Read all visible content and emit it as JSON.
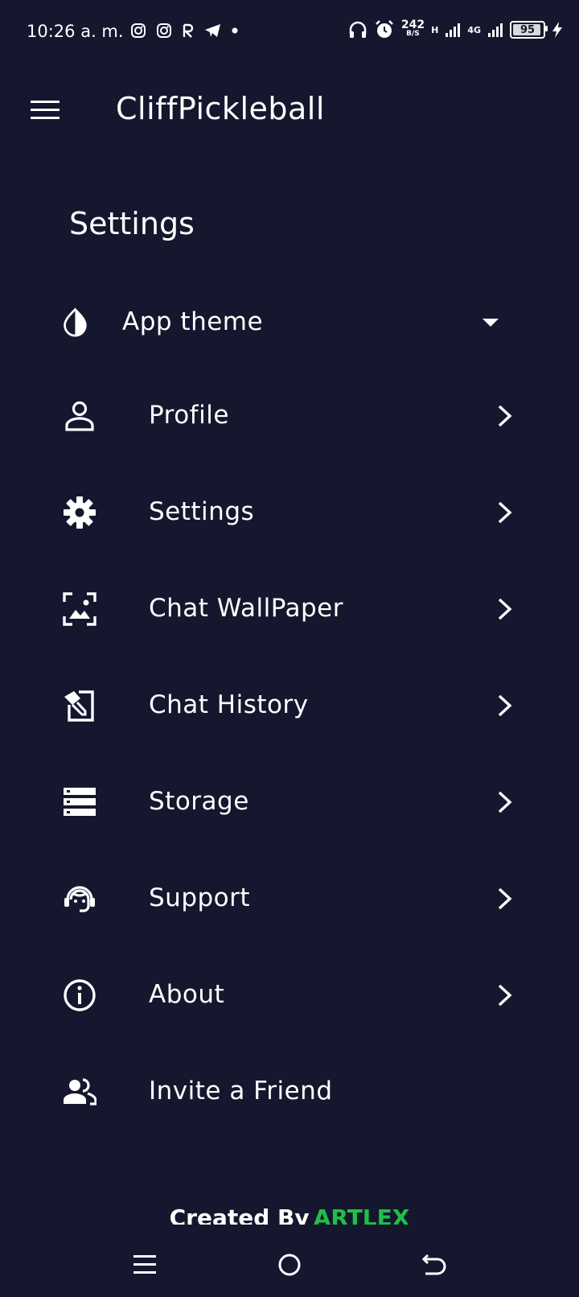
{
  "status": {
    "time": "10:26 a. m.",
    "speed_value": "242",
    "speed_unit": "B/S",
    "network_h": "H",
    "network_4g": "4G",
    "battery": "95",
    "battery_level": 0.95
  },
  "appbar": {
    "title": "CliffPickleball",
    "menu_icon": "hamburger-menu-icon"
  },
  "page": {
    "title": "Settings"
  },
  "theme": {
    "label": "App theme",
    "icon": "theme-drop-icon"
  },
  "menu": {
    "items": [
      {
        "label": "Profile",
        "icon": "person-icon"
      },
      {
        "label": "Settings",
        "icon": "gear-icon"
      },
      {
        "label": "Chat WallPaper",
        "icon": "wallpaper-icon"
      },
      {
        "label": "Chat History",
        "icon": "history-icon"
      },
      {
        "label": "Storage",
        "icon": "storage-icon"
      },
      {
        "label": "Support",
        "icon": "support-agent-icon"
      },
      {
        "label": "About",
        "icon": "info-icon"
      },
      {
        "label": "Invite a Friend",
        "icon": "group-icon"
      }
    ]
  },
  "footer": {
    "prefix": "Created By",
    "brand": "ARTLEX"
  },
  "colors": {
    "background": "#15172e",
    "text": "#ffffff",
    "brand": "#1fbf4a"
  }
}
